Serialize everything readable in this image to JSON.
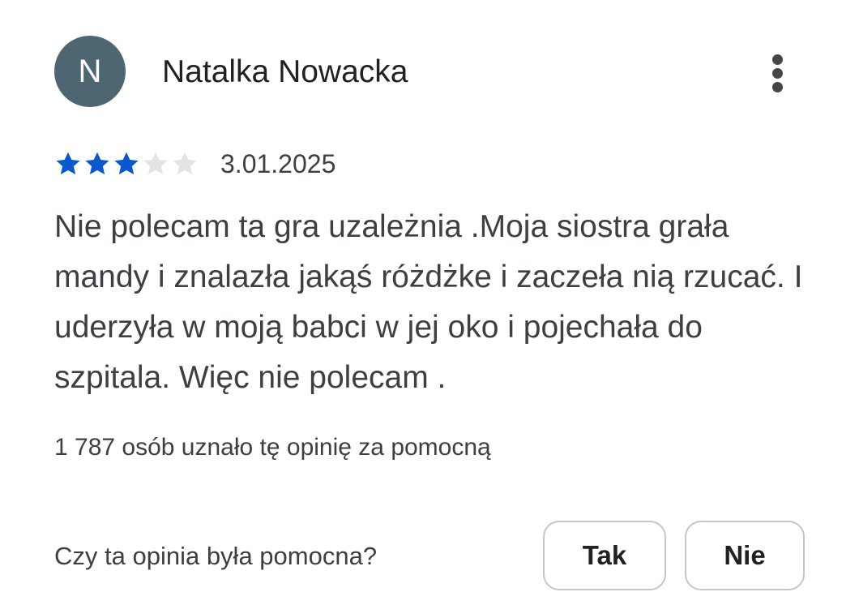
{
  "review": {
    "avatar_initial": "N",
    "author": "Natalka Nowacka",
    "more_icon": "more-vert-icon",
    "rating": 3,
    "rating_max": 5,
    "date": "3.01.2025",
    "text": "Nie polecam ta gra uzależnia .Moja siostra grała mandy i znalazła jakąś różdżke i zaczeła nią rzucać. I uderzyła w moją babci w jej oko i pojechała do szpitala. Więc nie polecam .",
    "helpful_count": "1 787 osób uznało tę opinię za pomocną"
  },
  "feedback": {
    "question": "Czy ta opinia była pomocna?",
    "yes_label": "Tak",
    "no_label": "Nie"
  },
  "colors": {
    "star_filled": "#0b57d0",
    "star_empty": "#e3e3e3",
    "avatar_bg": "#4e6572"
  }
}
